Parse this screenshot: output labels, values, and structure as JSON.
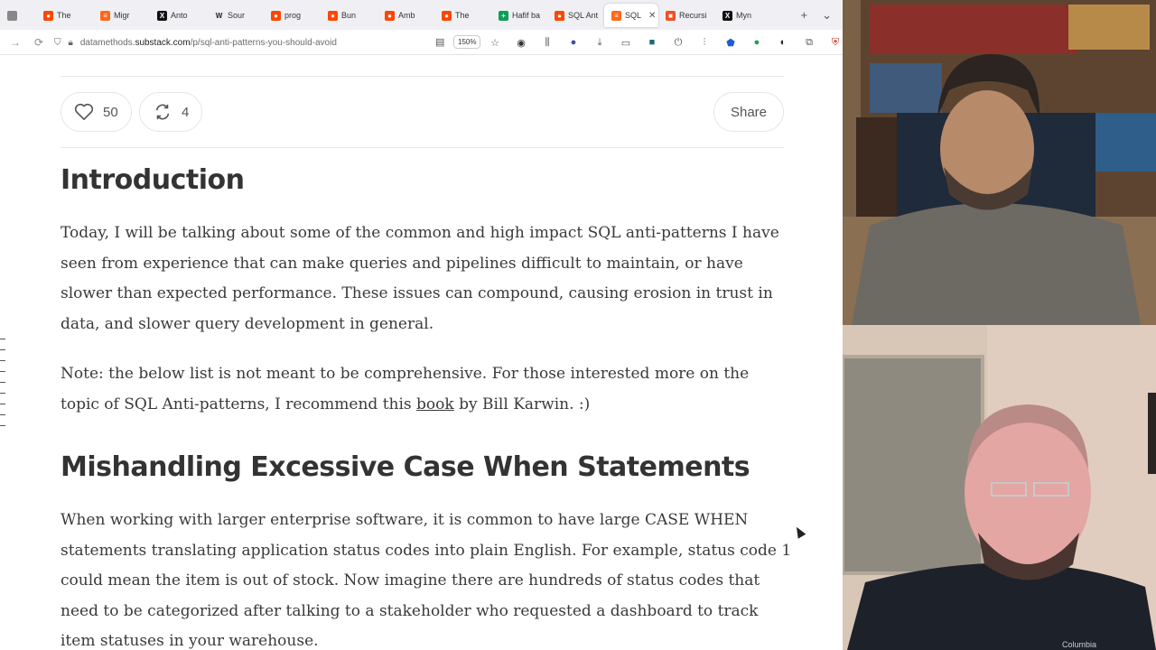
{
  "tabs": [
    {
      "label": "The",
      "icon": "reddit-icon",
      "color": "#ff4500"
    },
    {
      "label": "Migr",
      "icon": "substack-icon",
      "color": "#ff6719"
    },
    {
      "label": "Anto",
      "icon": "x-icon",
      "color": "#111111"
    },
    {
      "label": "Sour",
      "icon": "wikipedia-icon",
      "color": "#555555"
    },
    {
      "label": "prog",
      "icon": "reddit-icon",
      "color": "#ff4500"
    },
    {
      "label": "Bun",
      "icon": "reddit-icon",
      "color": "#ff4500"
    },
    {
      "label": "Amb",
      "icon": "reddit-icon",
      "color": "#ff4500"
    },
    {
      "label": "The",
      "icon": "reddit-icon",
      "color": "#ff4500"
    },
    {
      "label": "Hafif ba",
      "icon": "sheets-icon",
      "color": "#0f9d58"
    },
    {
      "label": "SQL Ant",
      "icon": "reddit-icon",
      "color": "#ff4500"
    },
    {
      "label": "SQL",
      "icon": "substack-icon",
      "color": "#ff6719",
      "active": true
    },
    {
      "label": "Recursi",
      "icon": "microsoft-icon",
      "color": "#f25022"
    },
    {
      "label": "Myn",
      "icon": "x-icon",
      "color": "#111111"
    }
  ],
  "url": {
    "prefix": "datamethods.",
    "host": "substack.com",
    "path": "/p/sql-anti-patterns-you-should-avoid"
  },
  "zoom": "150%",
  "post_actions": {
    "likes": "50",
    "restacks": "4",
    "share_label": "Share"
  },
  "article": {
    "intro_heading": "Introduction",
    "intro_paragraph": "Today, I will be talking about some of the common and high impact SQL anti-patterns I have seen from experience that can make queries and pipelines difficult to maintain, or have slower than expected performance. These issues can compound, causing erosion in trust in data, and slower query development in general.",
    "note_before": "Note: the below list is not meant to be comprehensive. For those interested more on the topic of SQL Anti-patterns, I recommend this ",
    "note_link": "book",
    "note_after": " by Bill Karwin. :)",
    "section_heading": "Mishandling Excessive Case When Statements",
    "section_paragraph": "When working with larger enterprise software, it is common to have large CASE WHEN statements translating application status codes into plain English. For example, status code 1 could mean the item is out of stock. Now imagine there are hundreds of status codes that need to be categorized after talking to a stakeholder who requested a dashboard to track item statuses in your warehouse."
  },
  "webcam_bottom": {
    "shirt_logo": "Columbia"
  }
}
